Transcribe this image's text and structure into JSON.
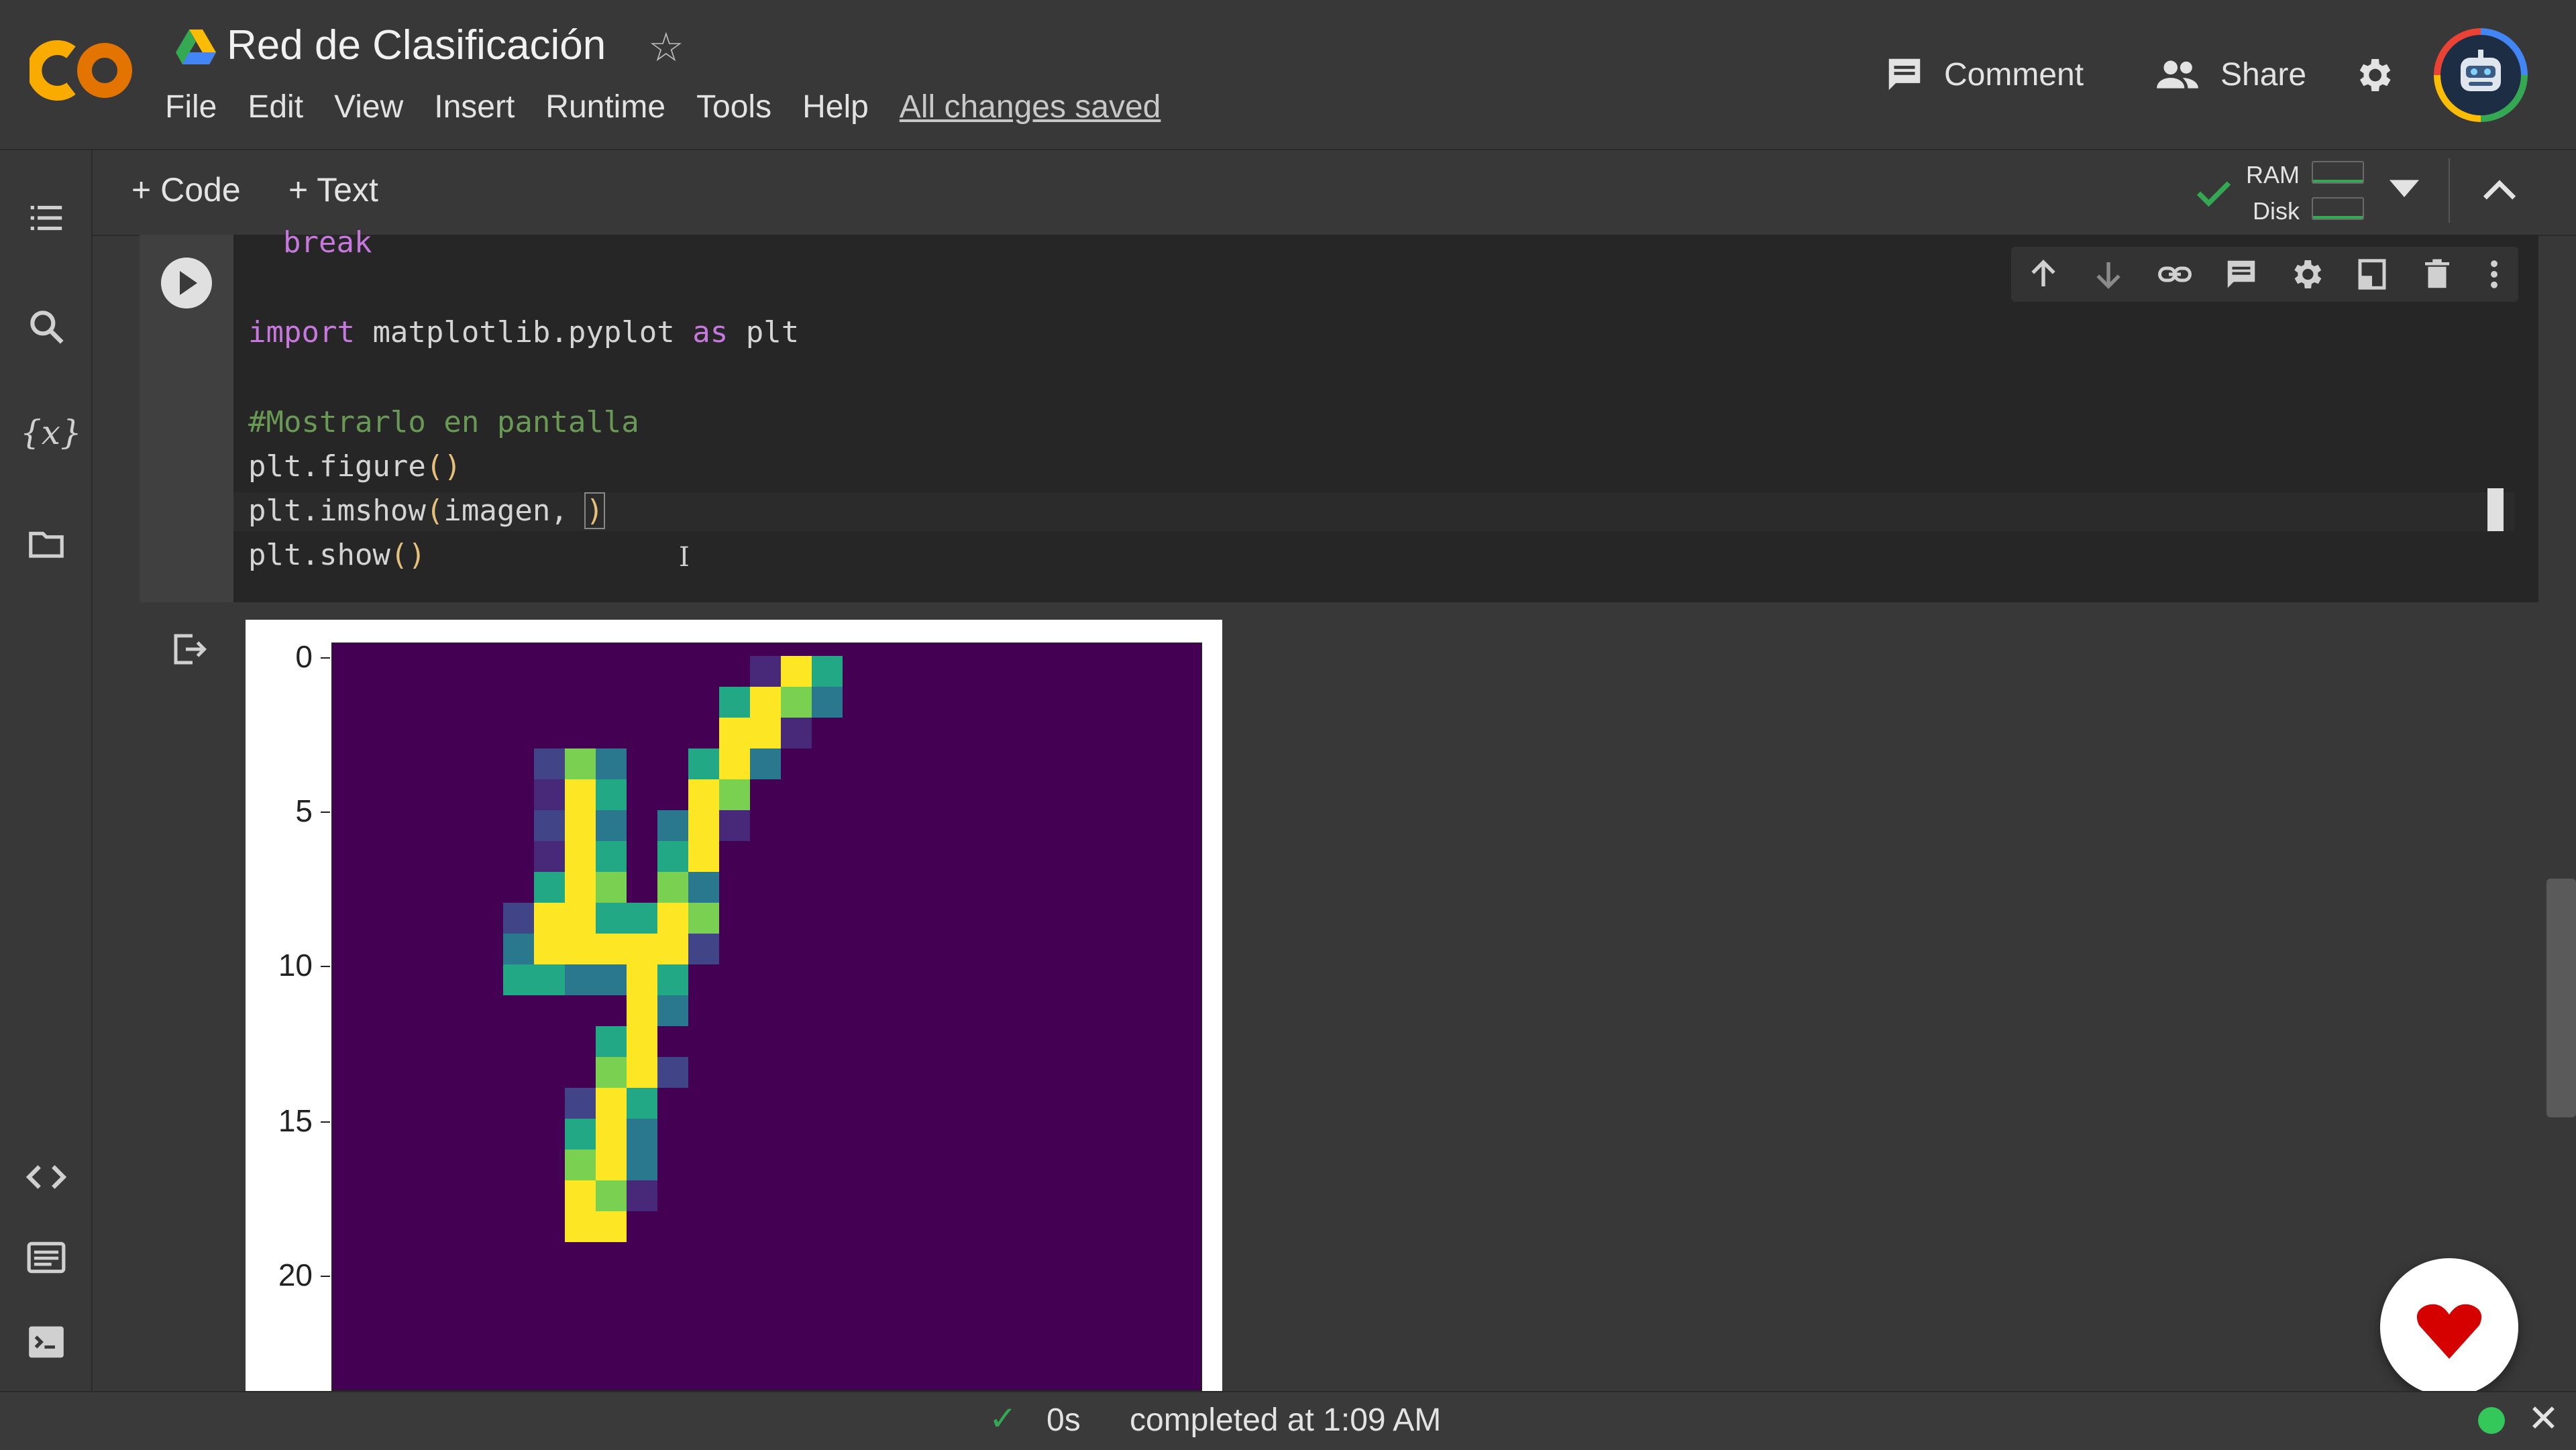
{
  "header": {
    "notebook_title": "Red de Clasificación",
    "menu": [
      "File",
      "Edit",
      "View",
      "Insert",
      "Runtime",
      "Tools",
      "Help"
    ],
    "save_status": "All changes saved",
    "comment_label": "Comment",
    "share_label": "Share"
  },
  "toolbar": {
    "add_code": "+ Code",
    "add_text": "+ Text",
    "ram_label": "RAM",
    "disk_label": "Disk"
  },
  "code": {
    "line1": "break",
    "line2_kw1": "import",
    "line2_mid": " matplotlib.pyplot ",
    "line2_kw2": "as",
    "line2_end": " plt",
    "line3": "#Mostrarlo en pantalla",
    "line4_a": "plt.figure",
    "line4_p": "()",
    "line5_a": "plt.imshow",
    "line5_p1": "(",
    "line5_b": "imagen, ",
    "line5_p2": ")",
    "line6_a": "plt.show",
    "line6_p": "()"
  },
  "plot": {
    "yticks": [
      "0",
      "5",
      "10",
      "15",
      "20"
    ]
  },
  "status": {
    "time": "0s",
    "message": "completed at 1:09 AM"
  },
  "colors": {
    "accent_orange": "#f9ab00",
    "viridis_dark": "#440154",
    "viridis_yellow": "#fde725"
  }
}
